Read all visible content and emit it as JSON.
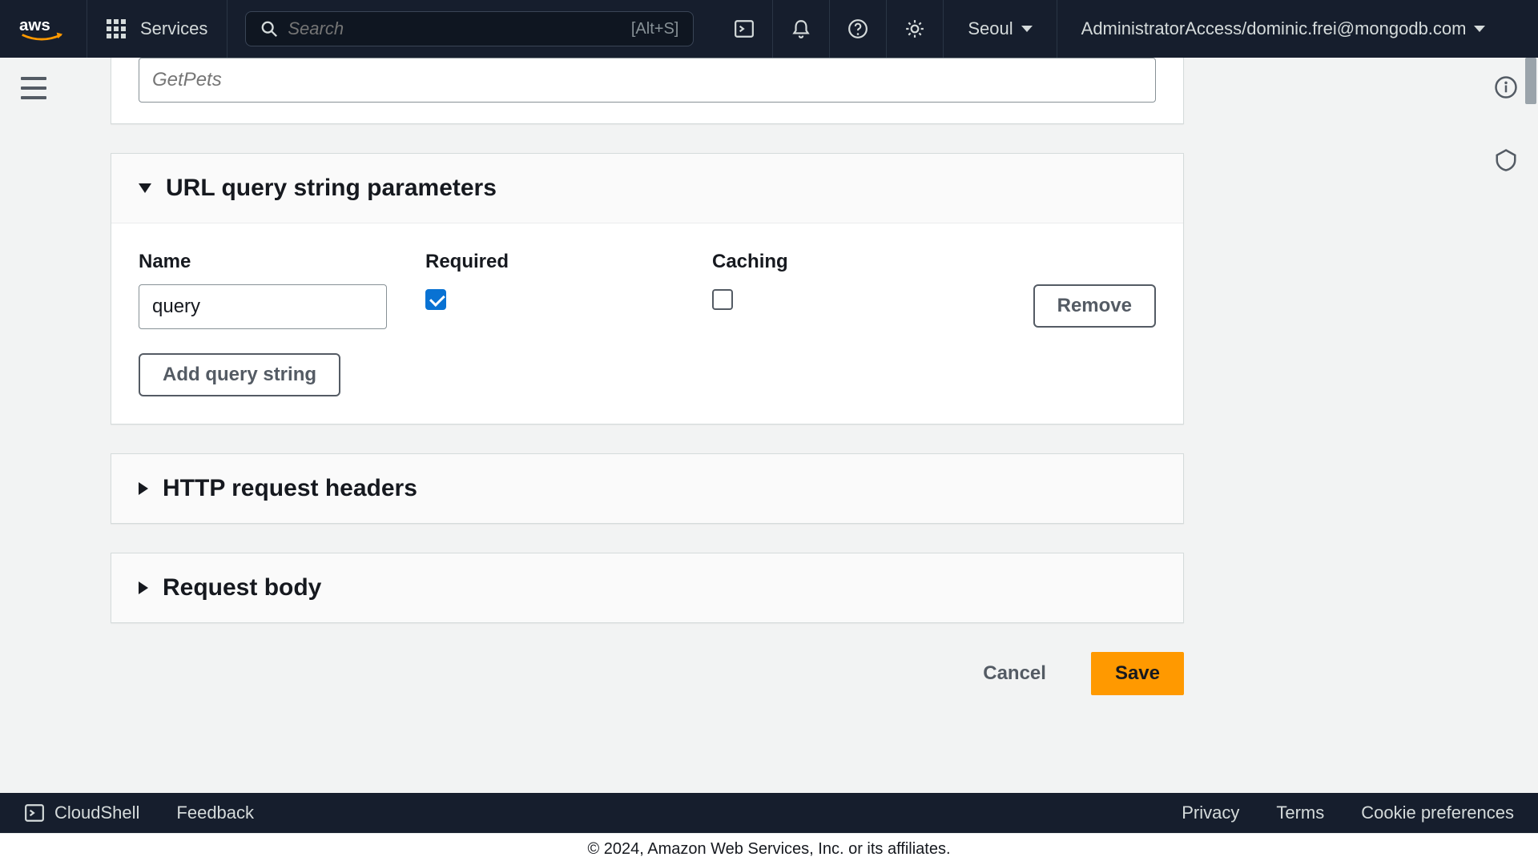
{
  "topnav": {
    "services_label": "Services",
    "search_placeholder": "Search",
    "search_shortcut": "[Alt+S]",
    "region": "Seoul",
    "account": "AdministratorAccess/dominic.frei@mongodb.com"
  },
  "peek_input": {
    "placeholder": "GetPets"
  },
  "sections": {
    "url_qs": {
      "title": "URL query string parameters",
      "cols": {
        "name": "Name",
        "required": "Required",
        "caching": "Caching"
      },
      "rows": [
        {
          "name_value": "query",
          "required": true,
          "caching": false,
          "remove_label": "Remove"
        }
      ],
      "add_label": "Add query string"
    },
    "headers": {
      "title": "HTTP request headers"
    },
    "body": {
      "title": "Request body"
    }
  },
  "actions": {
    "cancel": "Cancel",
    "save": "Save"
  },
  "footer": {
    "cloudshell": "CloudShell",
    "feedback": "Feedback",
    "privacy": "Privacy",
    "terms": "Terms",
    "cookies": "Cookie preferences",
    "copyright": "© 2024, Amazon Web Services, Inc. or its affiliates."
  }
}
